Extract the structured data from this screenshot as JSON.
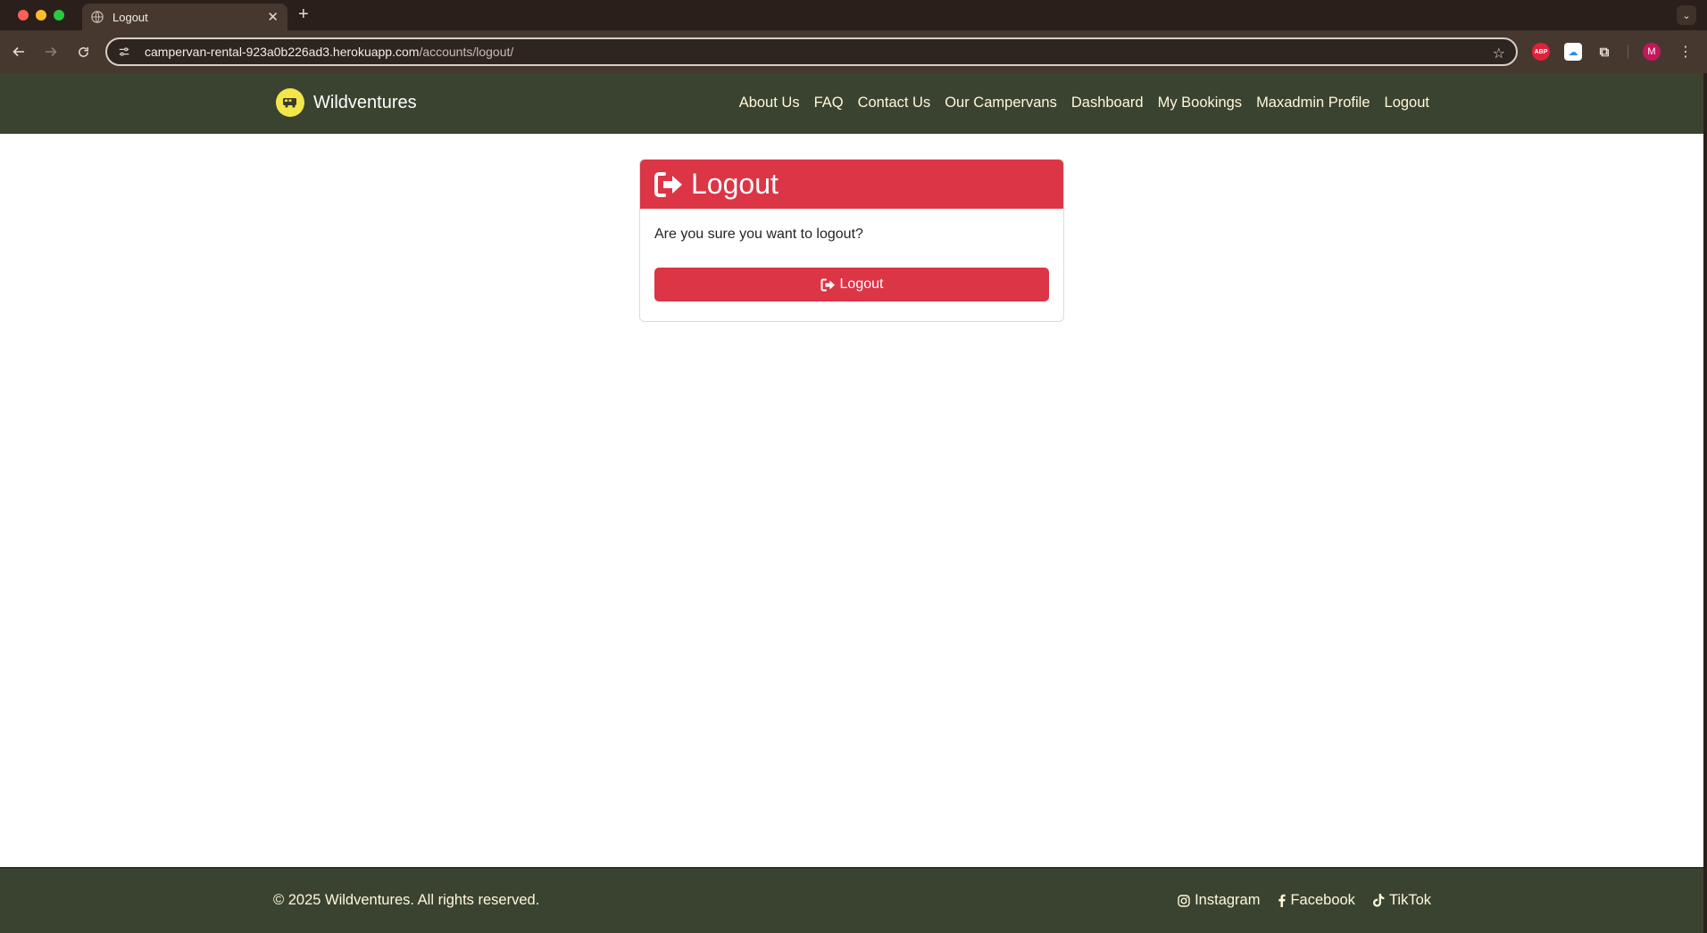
{
  "browser": {
    "tab_title": "Logout",
    "url_host": "campervan-rental-923a0b226ad3.herokuapp.com",
    "url_path": "/accounts/logout/",
    "ext_abp_label": "ABP",
    "profile_initial": "M"
  },
  "navbar": {
    "brand": "Wildventures",
    "links": [
      "About Us",
      "FAQ",
      "Contact Us",
      "Our Campervans",
      "Dashboard",
      "My Bookings",
      "Maxadmin Profile",
      "Logout"
    ]
  },
  "card": {
    "title": "Logout",
    "message": "Are you sure you want to logout?",
    "button_label": "Logout",
    "accent_color": "#dc3545"
  },
  "footer": {
    "copyright": "© 2025 Wildventures. All rights reserved.",
    "socials": [
      "Instagram",
      "Facebook",
      "TikTok"
    ]
  },
  "colors": {
    "nav_bg": "#3a432f",
    "nav_text": "#fff8dc",
    "brand_logo": "#f2e64a"
  }
}
